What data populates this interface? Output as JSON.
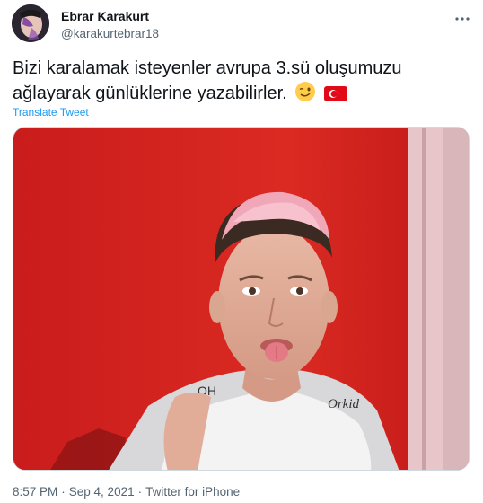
{
  "author": {
    "display_name": "Ebrar Karakurt",
    "handle": "@karakurtebrar18"
  },
  "tweet": {
    "lines": [
      "Bizi karalamak isteyenler avrupa 3.sü oluşumuzu",
      "ağlayarak günlüklerine yazabilirler."
    ],
    "emojis": [
      "winking-face",
      "turkey-flag"
    ],
    "translate_label": "Translate Tweet"
  },
  "media": {
    "jersey_text_left": "OH",
    "jersey_text_right": "Orkid"
  },
  "meta": {
    "time": "8:57 PM",
    "date": "Sep 4, 2021",
    "source": "Twitter for iPhone",
    "separator": "·"
  },
  "colors": {
    "accent": "#1d9bf0",
    "text_primary": "#0f1419",
    "text_secondary": "#536471",
    "background_wall": "#d62828"
  }
}
